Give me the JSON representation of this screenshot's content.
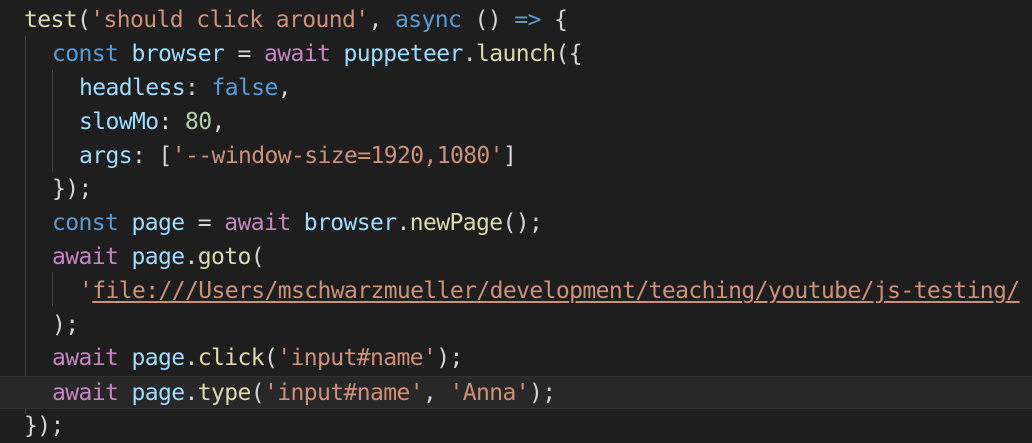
{
  "code": {
    "lines": [
      [
        {
          "t": "test",
          "c": "fn"
        },
        {
          "t": "(",
          "c": "pu"
        },
        {
          "t": "'should click around'",
          "c": "st"
        },
        {
          "t": ", ",
          "c": "pu"
        },
        {
          "t": "async",
          "c": "kw"
        },
        {
          "t": " () ",
          "c": "pu"
        },
        {
          "t": "=>",
          "c": "kw"
        },
        {
          "t": " {",
          "c": "pu"
        }
      ],
      [
        {
          "t": "const",
          "c": "kw"
        },
        {
          "t": " ",
          "c": "pu"
        },
        {
          "t": "browser",
          "c": "var"
        },
        {
          "t": " = ",
          "c": "pu"
        },
        {
          "t": "await",
          "c": "aw"
        },
        {
          "t": " ",
          "c": "pu"
        },
        {
          "t": "puppeteer",
          "c": "var"
        },
        {
          "t": ".",
          "c": "pu"
        },
        {
          "t": "launch",
          "c": "fn"
        },
        {
          "t": "({",
          "c": "pu"
        }
      ],
      [
        {
          "t": "headless",
          "c": "pr"
        },
        {
          "t": ": ",
          "c": "pu"
        },
        {
          "t": "false",
          "c": "kw"
        },
        {
          "t": ",",
          "c": "pu"
        }
      ],
      [
        {
          "t": "slowMo",
          "c": "pr"
        },
        {
          "t": ": ",
          "c": "pu"
        },
        {
          "t": "80",
          "c": "num"
        },
        {
          "t": ",",
          "c": "pu"
        }
      ],
      [
        {
          "t": "args",
          "c": "pr"
        },
        {
          "t": ": [",
          "c": "pu"
        },
        {
          "t": "'--window-size=1920,1080'",
          "c": "st"
        },
        {
          "t": "]",
          "c": "pu"
        }
      ],
      [
        {
          "t": "});",
          "c": "pu"
        }
      ],
      [
        {
          "t": "const",
          "c": "kw"
        },
        {
          "t": " ",
          "c": "pu"
        },
        {
          "t": "page",
          "c": "var"
        },
        {
          "t": " = ",
          "c": "pu"
        },
        {
          "t": "await",
          "c": "aw"
        },
        {
          "t": " ",
          "c": "pu"
        },
        {
          "t": "browser",
          "c": "var"
        },
        {
          "t": ".",
          "c": "pu"
        },
        {
          "t": "newPage",
          "c": "fn"
        },
        {
          "t": "();",
          "c": "pu"
        }
      ],
      [
        {
          "t": "await",
          "c": "aw"
        },
        {
          "t": " ",
          "c": "pu"
        },
        {
          "t": "page",
          "c": "var"
        },
        {
          "t": ".",
          "c": "pu"
        },
        {
          "t": "goto",
          "c": "fn"
        },
        {
          "t": "(",
          "c": "pu"
        }
      ],
      [
        {
          "t": "'",
          "c": "st"
        },
        {
          "t": "file:///Users/mschwarzmueller/development/teaching/youtube/js-testing/",
          "c": "url"
        }
      ],
      [
        {
          "t": ");",
          "c": "pu"
        }
      ],
      [
        {
          "t": "await",
          "c": "aw"
        },
        {
          "t": " ",
          "c": "pu"
        },
        {
          "t": "page",
          "c": "var"
        },
        {
          "t": ".",
          "c": "pu"
        },
        {
          "t": "click",
          "c": "fn"
        },
        {
          "t": "(",
          "c": "pu"
        },
        {
          "t": "'input#name'",
          "c": "st"
        },
        {
          "t": ");",
          "c": "pu"
        }
      ],
      [
        {
          "t": "await",
          "c": "aw"
        },
        {
          "t": " ",
          "c": "pu"
        },
        {
          "t": "page",
          "c": "var"
        },
        {
          "t": ".",
          "c": "pu"
        },
        {
          "t": "type",
          "c": "fn"
        },
        {
          "t": "(",
          "c": "pu"
        },
        {
          "t": "'input#name'",
          "c": "st"
        },
        {
          "t": ", ",
          "c": "pu"
        },
        {
          "t": "'Anna'",
          "c": "st"
        },
        {
          "t": ");",
          "c": "pu"
        }
      ],
      [
        {
          "t": "});",
          "c": "pu"
        }
      ]
    ]
  },
  "colors": {
    "background": "#1e1e1e",
    "function": "#dcdcaa",
    "string": "#ce9178",
    "keyword": "#569cd6",
    "await": "#c586c0",
    "variable": "#9cdcfe",
    "number": "#b5cea8",
    "punctuation": "#d4d4d4"
  }
}
